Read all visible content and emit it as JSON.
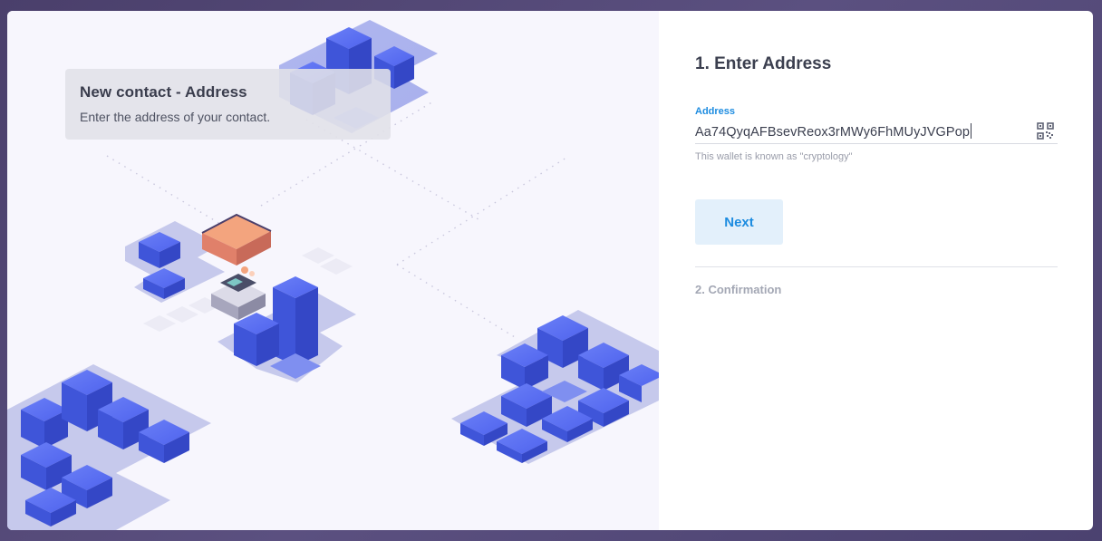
{
  "tooltip": {
    "title": "New contact - Address",
    "subtitle": "Enter the address of your contact."
  },
  "form": {
    "step1_title": "1. Enter Address",
    "address_label": "Address",
    "address_value": "Aa74QyqAFBsevReox3rMWy6FhMUyJVGPop",
    "hint": "This wallet is known as \"cryptology\"",
    "next_label": "Next",
    "step2_title": "2. Confirmation"
  },
  "icons": {
    "qr": "qr-code-icon"
  },
  "colors": {
    "accent": "#1d8ce0",
    "button_bg": "#e3f0fb",
    "block_blue": "#4e67ee",
    "illustration_bg": "#f7f6fd"
  }
}
